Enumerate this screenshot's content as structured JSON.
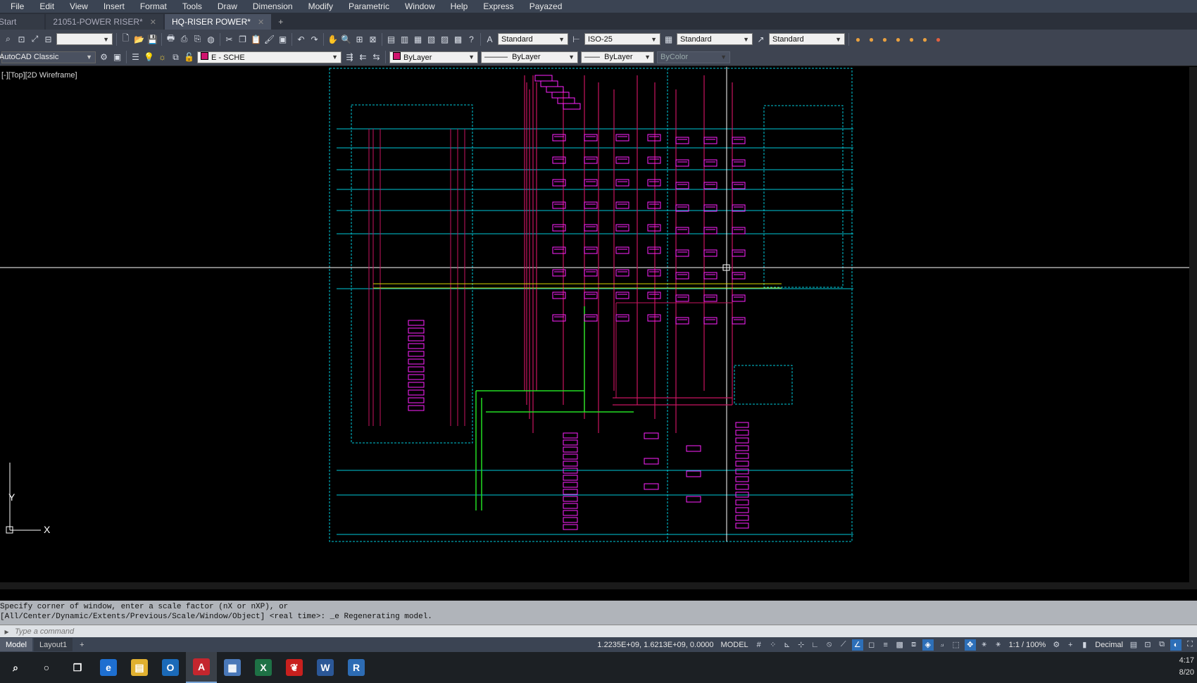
{
  "menu": [
    "File",
    "Edit",
    "View",
    "Insert",
    "Format",
    "Tools",
    "Draw",
    "Dimension",
    "Modify",
    "Parametric",
    "Window",
    "Help",
    "Express",
    "Payazed"
  ],
  "file_tabs": [
    {
      "label": "Start",
      "active": false,
      "closable": false
    },
    {
      "label": "21051-POWER RISER*",
      "active": false,
      "closable": true
    },
    {
      "label": "HQ-RISER POWER*",
      "active": true,
      "closable": true
    }
  ],
  "toolbar1": {
    "text_style": "Standard",
    "dim_style": "ISO-25",
    "table_style": "Standard",
    "mleader_style": "Standard"
  },
  "toolbar2": {
    "workspace": "AutoCAD Classic",
    "layer": "E - SCHE",
    "color": "ByLayer",
    "linetype": "ByLayer",
    "lineweight": "ByLayer",
    "plotstyle": "ByColor"
  },
  "viewport": {
    "label": "[-][Top][2D Wireframe]",
    "ucs_x": "X",
    "ucs_y": "Y",
    "colors": {
      "frame": "#00c8d8",
      "main": "#c8145f",
      "green": "#22dd22",
      "yellow": "#d8d800",
      "magenta": "#ff22ff",
      "white": "#ffffff"
    }
  },
  "command": {
    "history": [
      "Specify corner of window, enter a scale factor (nX or nXP), or",
      "[All/Center/Dynamic/Extents/Previous/Scale/Window/Object] <real time>: _e Regenerating model."
    ],
    "placeholder": "Type a command"
  },
  "layout_tabs": [
    "Model",
    "Layout1"
  ],
  "status": {
    "coords": "1.2235E+09, 1.6213E+09, 0.0000",
    "space": "MODEL",
    "scale": "1:1 / 100%",
    "units": "Decimal"
  },
  "taskbar": {
    "apps": [
      {
        "name": "search-icon",
        "glyph": "⌕",
        "color": "transparent"
      },
      {
        "name": "cortana-icon",
        "glyph": "○",
        "color": "transparent"
      },
      {
        "name": "task-view-icon",
        "glyph": "❐",
        "color": "transparent"
      },
      {
        "name": "internet-explorer-icon",
        "glyph": "e",
        "color": "#1e6fd0"
      },
      {
        "name": "file-explorer-icon",
        "glyph": "▤",
        "color": "#e0b030"
      },
      {
        "name": "outlook-icon",
        "glyph": "O",
        "color": "#1b6ab8"
      },
      {
        "name": "autocad-icon",
        "glyph": "A",
        "color": "#c4262e"
      },
      {
        "name": "calculator-icon",
        "glyph": "▦",
        "color": "#4a78b8"
      },
      {
        "name": "excel-icon",
        "glyph": "X",
        "color": "#1e7145"
      },
      {
        "name": "acrobat-icon",
        "glyph": "❦",
        "color": "#c8201e"
      },
      {
        "name": "word-icon",
        "glyph": "W",
        "color": "#2b5797"
      },
      {
        "name": "revit-icon",
        "glyph": "R",
        "color": "#2d6cb4"
      }
    ],
    "time": "4:17",
    "date": "8/20"
  }
}
